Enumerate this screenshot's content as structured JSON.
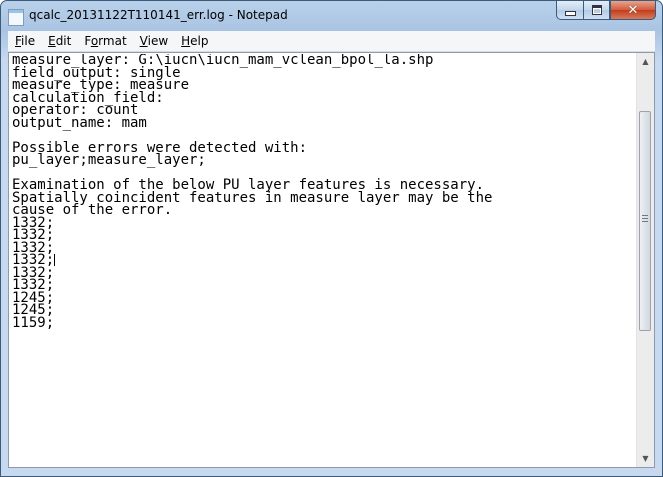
{
  "window": {
    "title": "qcalc_20131122T110141_err.log - Notepad",
    "close_symbol": "✕"
  },
  "menu": {
    "items": [
      {
        "mnemonic": "F",
        "rest": "ile"
      },
      {
        "mnemonic": "E",
        "rest": "dit"
      },
      {
        "mnemonic": "F",
        "rest": "o",
        "after": "rmat",
        "underline_index": 1
      },
      {
        "mnemonic": "V",
        "rest": "iew"
      },
      {
        "mnemonic": "H",
        "rest": "elp"
      }
    ]
  },
  "document": {
    "lines": [
      "measure_layer: G:\\iucn\\iucn_mam_vclean_bpol_la.shp",
      "field_output: single",
      "measure_type: measure",
      "calculation_field:",
      "operator: count",
      "output_name: mam",
      "",
      "Possible errors were detected with:",
      "pu_layer;measure_layer;",
      "",
      "Examination of the below PU layer features is necessary.",
      "Spatially coincident features in measure layer may be the",
      "cause of the error.",
      "1332;",
      "1332;",
      "1332;",
      "1332;",
      "1332;",
      "1332;",
      "1245;",
      "1245;",
      "1159;"
    ],
    "caret_line": 16
  },
  "icons": {
    "app": "notepad-icon",
    "minimize": "minimize-icon",
    "maximize": "maximize-icon",
    "close": "close-icon",
    "scroll_up": "scroll-up-arrow-icon",
    "scroll_down": "scroll-down-arrow-icon"
  }
}
